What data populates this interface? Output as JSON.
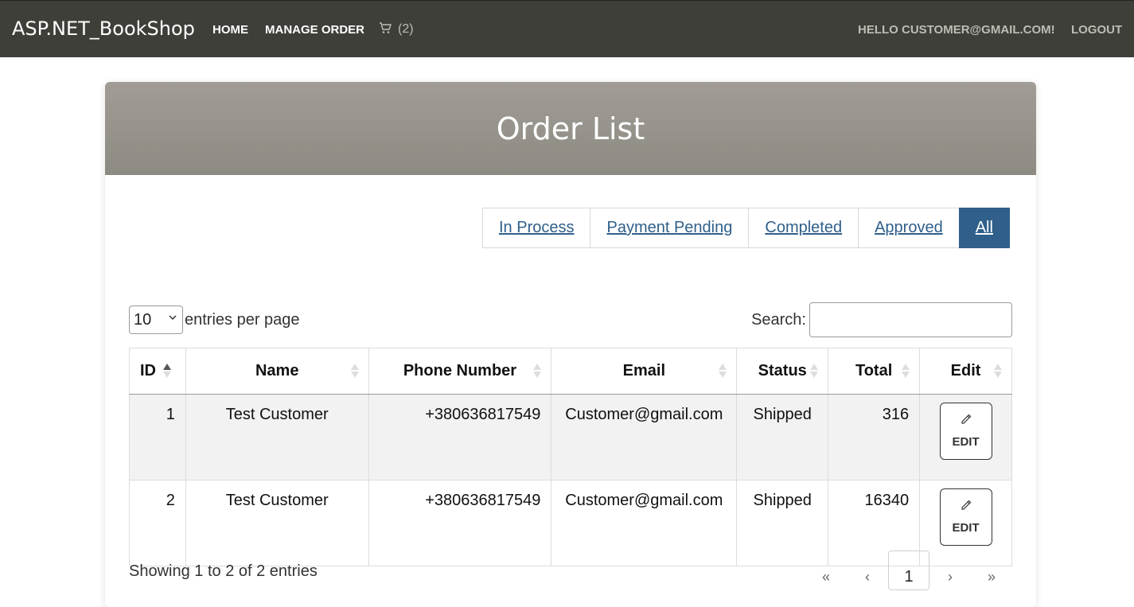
{
  "navbar": {
    "brand": "ASP.NET_BookShop",
    "home": "HOME",
    "manage_order": "MANAGE ORDER",
    "cart_count": "(2)",
    "greeting": "HELLO CUSTOMER@GMAIL.COM!",
    "logout": "LOGOUT"
  },
  "page": {
    "title": "Order List"
  },
  "filters": [
    {
      "label": "In Process"
    },
    {
      "label": "Payment Pending"
    },
    {
      "label": "Completed"
    },
    {
      "label": "Approved"
    },
    {
      "label": "All"
    }
  ],
  "active_filter": "All",
  "table_controls": {
    "page_length": "10",
    "length_label": "entries per page",
    "search_label": "Search:",
    "search_value": ""
  },
  "table": {
    "columns": [
      "ID",
      "Name",
      "Phone Number",
      "Email",
      "Status",
      "Total",
      "Edit"
    ],
    "rows": [
      {
        "id": "1",
        "name": "Test Customer",
        "phone": "+380636817549",
        "email": "Customer@gmail.com",
        "status": "Shipped",
        "total": "316",
        "edit": "EDIT"
      },
      {
        "id": "2",
        "name": "Test Customer",
        "phone": "+380636817549",
        "email": "Customer@gmail.com",
        "status": "Shipped",
        "total": "16340",
        "edit": "EDIT"
      }
    ]
  },
  "footer": {
    "info": "Showing 1 to 2 of 2 entries",
    "pager": {
      "first": "«",
      "prev": "‹",
      "current": "1",
      "next": "›",
      "last": "»"
    }
  },
  "colors": {
    "navbar_bg": "#3f3f3a",
    "header_bg": "#9a968f",
    "accent": "#2f5f8a"
  }
}
